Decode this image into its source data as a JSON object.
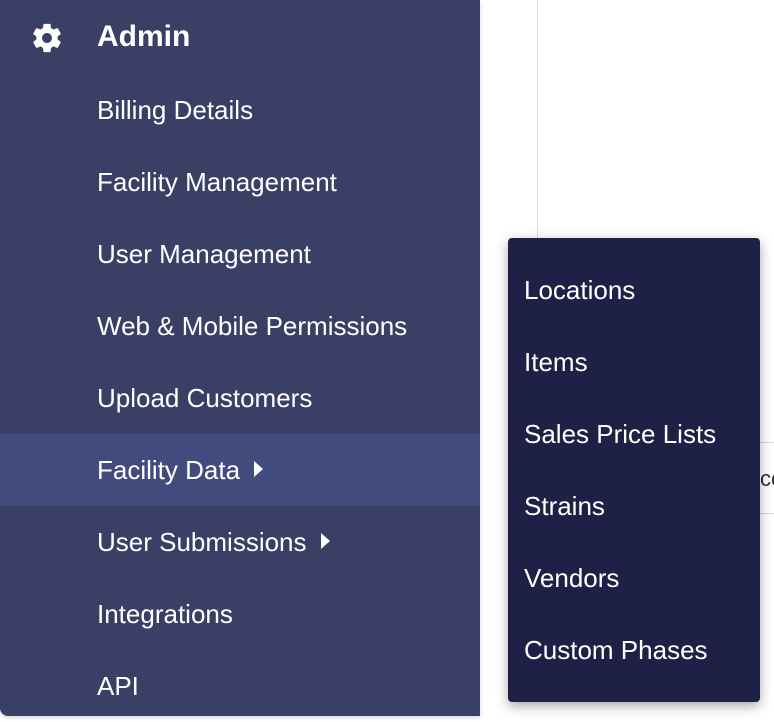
{
  "sidebar": {
    "header": {
      "icon": "gear-icon",
      "title": "Admin"
    },
    "items": [
      {
        "label": "Billing Details",
        "has_submenu": false,
        "active": false
      },
      {
        "label": "Facility Management",
        "has_submenu": false,
        "active": false
      },
      {
        "label": "User Management",
        "has_submenu": false,
        "active": false
      },
      {
        "label": "Web & Mobile Permissions",
        "has_submenu": false,
        "active": false
      },
      {
        "label": "Upload Customers",
        "has_submenu": false,
        "active": false
      },
      {
        "label": "Facility Data",
        "has_submenu": true,
        "active": true
      },
      {
        "label": "User Submissions",
        "has_submenu": true,
        "active": false
      },
      {
        "label": "Integrations",
        "has_submenu": false,
        "active": false
      },
      {
        "label": "API",
        "has_submenu": false,
        "active": false
      }
    ]
  },
  "flyout": {
    "parent": "Facility Data",
    "items": [
      {
        "label": "Locations"
      },
      {
        "label": "Items"
      },
      {
        "label": "Sales Price Lists"
      },
      {
        "label": "Strains"
      },
      {
        "label": "Vendors"
      },
      {
        "label": "Custom Phases"
      }
    ]
  },
  "background": {
    "row_text": "co"
  },
  "colors": {
    "sidebar_bg": "#3a3f66",
    "sidebar_active_bg": "#434b7e",
    "flyout_bg": "#1f2045",
    "text": "#ffffff"
  }
}
